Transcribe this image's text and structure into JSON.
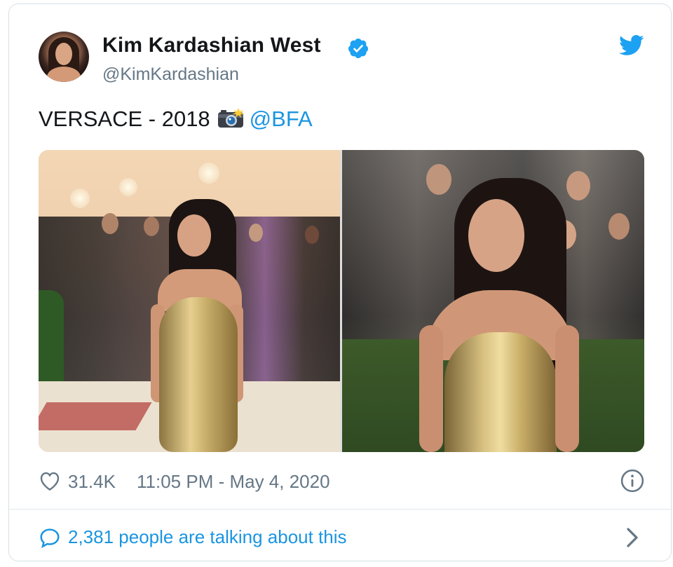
{
  "author": {
    "display_name": "Kim Kardashian West",
    "handle": "@KimKardashian",
    "verified": true
  },
  "tweet": {
    "text": "VERSACE - 2018",
    "emoji": "camera-with-flash-icon",
    "mention": "@BFA"
  },
  "media": {
    "photos": [
      "photo-left",
      "photo-right"
    ]
  },
  "stats": {
    "likes": "31.4K",
    "timestamp": "11:05 PM - May 4, 2020"
  },
  "conversation": {
    "label": "2,381 people are talking about this"
  },
  "colors": {
    "brand": "#1da1f2",
    "link": "#1b95e0",
    "muted": "#657786",
    "text": "#14171a"
  },
  "icons": [
    "twitter-bird-icon",
    "verified-badge-icon",
    "heart-icon",
    "info-icon",
    "comment-bubble-icon",
    "chevron-right-icon"
  ]
}
